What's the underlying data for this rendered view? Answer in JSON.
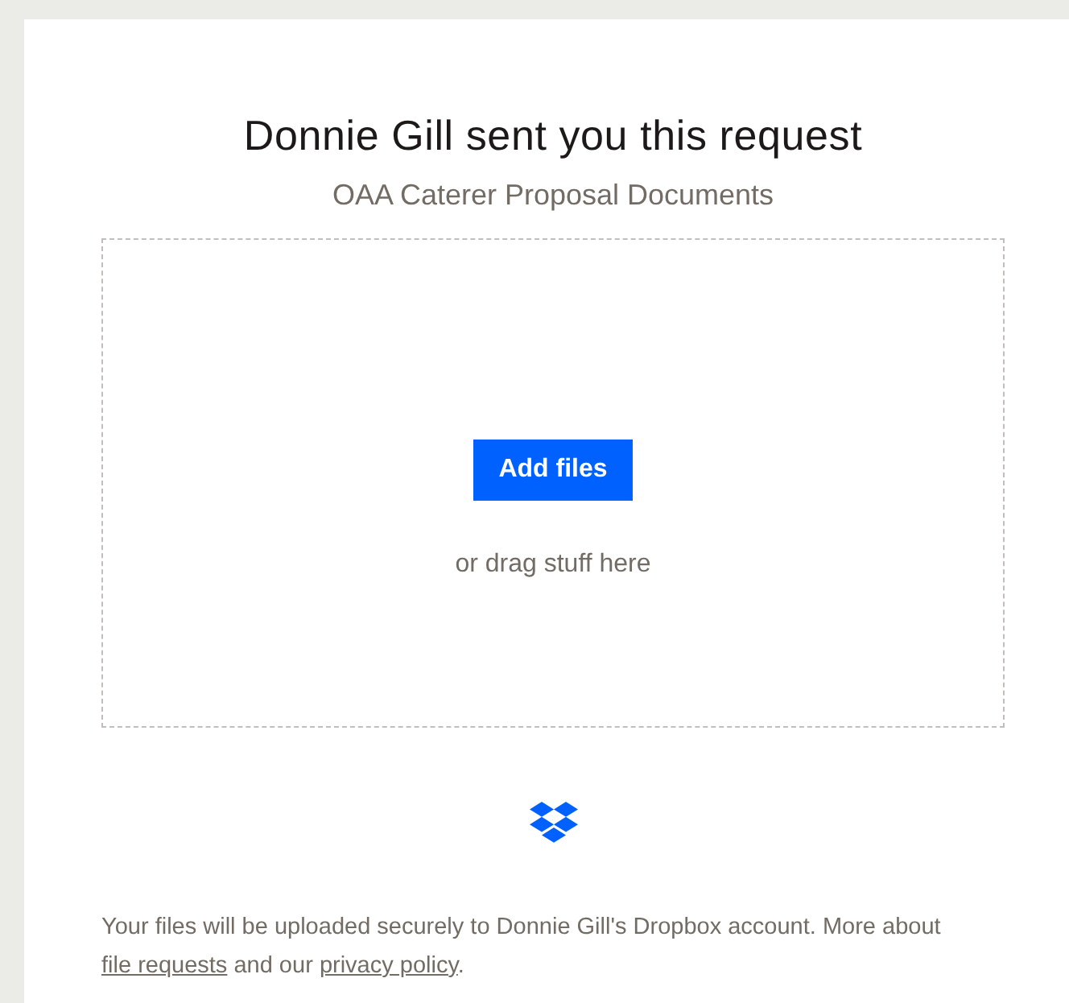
{
  "title": "Donnie Gill sent you this request",
  "subtitle": "OAA Caterer Proposal Documents",
  "dropzone": {
    "button": "Add files",
    "hint": "or drag stuff here"
  },
  "footer": {
    "text_before": "Your files will be uploaded securely to Donnie Gill's Dropbox account. More about ",
    "link_1": "file requests",
    "text_middle": " and our ",
    "link_2": "privacy policy",
    "text_end": "."
  }
}
